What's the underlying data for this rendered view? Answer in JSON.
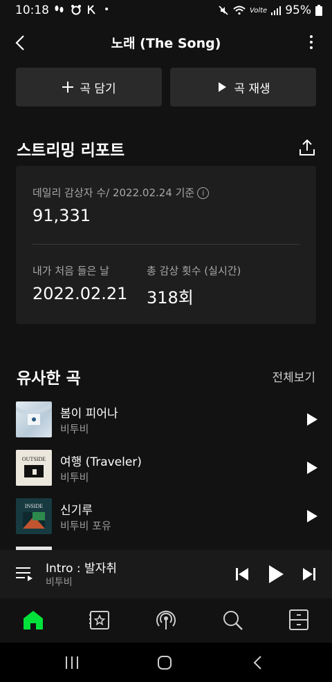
{
  "status_bar": {
    "time": "10:18",
    "battery": "95%",
    "network": "Volte"
  },
  "header": {
    "title": "노래 (The Song)"
  },
  "actions": {
    "add_label": "곡 담기",
    "play_label": "곡 재생"
  },
  "report": {
    "title": "스트리밍 리포트",
    "daily_listeners_label": "데일리 감상자 수/ 2022.02.24 기준",
    "daily_listeners_value": "91,331",
    "first_listen_label": "내가 처음 들은 날",
    "first_listen_value": "2022.02.21",
    "total_plays_label": "총 감상 횟수 (실시간)",
    "total_plays_value": "318회"
  },
  "similar": {
    "title": "유사한 곡",
    "view_all": "전체보기",
    "songs": [
      {
        "title": "봄이 피어나",
        "artist": "비투비"
      },
      {
        "title": "여행 (Traveler)",
        "artist": "비투비",
        "art_text": "OUTSIDE"
      },
      {
        "title": "신기루",
        "artist": "비투비 포유",
        "art_text": "INSIDE"
      }
    ]
  },
  "player": {
    "title": "Intro : 발자취",
    "artist": "비투비"
  },
  "colors": {
    "accent": "#00e23a",
    "background": "#121212",
    "card": "#1e1e1e",
    "button": "#2a2a2a"
  },
  "icons": {
    "nav": [
      "home-icon",
      "library-icon",
      "podcast-icon",
      "search-icon",
      "menu-icon"
    ]
  }
}
